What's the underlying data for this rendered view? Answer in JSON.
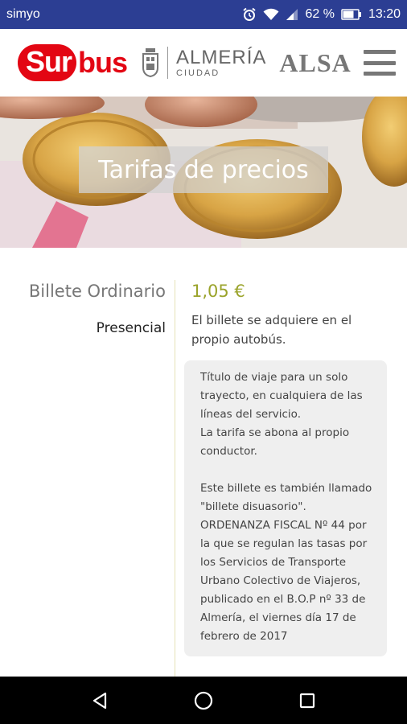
{
  "status_bar": {
    "carrier": "simyo",
    "battery": "62 %",
    "time": "13:20"
  },
  "header": {
    "logo_sur": "Sur",
    "logo_bus": "bus",
    "city_name": "ALMERÍA",
    "city_sub": "CIUDAD",
    "operator": "ALSA"
  },
  "hero": {
    "title": "Tarifas de precios"
  },
  "ticket": {
    "name": "Billete Ordinario",
    "mode": "Presencial",
    "price": "1,05 €",
    "purchase": "El billete se adquiere en el propio autobús.",
    "info": [
      "Título de viaje para un solo trayecto, en cualquiera de las líneas del servicio.",
      "La tarifa se abona al propio conductor.",
      "Este billete es también llamado \"billete disuasorio\". ORDENANZA FISCAL Nº 44 por la que se regulan las tasas por los Servicios de Transporte Urbano Colectivo de Viajeros, publicado en el B.O.P nº 33 de Almería, el viernes día 17 de febrero de 2017"
    ]
  },
  "colors": {
    "status_bar": "#2c3e93",
    "brand_red": "#e30613",
    "price_green": "#9aa32a"
  },
  "icons": {
    "alarm": "alarm-icon",
    "wifi": "wifi-icon",
    "signal": "signal-icon",
    "battery": "battery-icon",
    "menu": "hamburger-menu-icon",
    "back": "back-icon",
    "home": "home-icon",
    "recents": "recents-icon"
  }
}
